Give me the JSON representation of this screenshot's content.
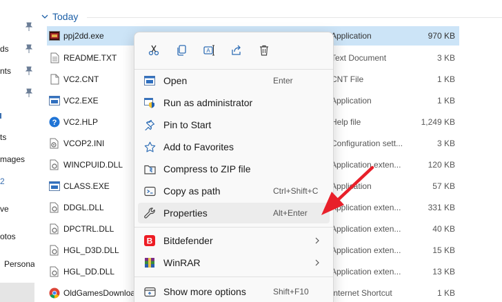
{
  "nav": {
    "items": [
      {
        "label": "ds"
      },
      {
        "label": "nts"
      },
      {
        "label": "ts"
      },
      {
        "label": "mages"
      },
      {
        "label": "2"
      },
      {
        "label": "ve"
      },
      {
        "label": "otos"
      },
      {
        "label": "Personal"
      }
    ]
  },
  "group": {
    "label": "Today"
  },
  "files": [
    {
      "name": "ppj2dd.exe",
      "type": "Application",
      "size": "970 KB",
      "icon": "app-exe-icon"
    },
    {
      "name": "README.TXT",
      "type": "Text Document",
      "size": "3 KB",
      "icon": "text-file-icon"
    },
    {
      "name": "VC2.CNT",
      "type": "CNT File",
      "size": "1 KB",
      "icon": "generic-file-icon"
    },
    {
      "name": "VC2.EXE",
      "type": "Application",
      "size": "1 KB",
      "icon": "window-exe-icon"
    },
    {
      "name": "VC2.HLP",
      "type": "Help file",
      "size": "1,249 KB",
      "icon": "help-file-icon"
    },
    {
      "name": "VCOP2.INI",
      "type": "Configuration sett...",
      "size": "3 KB",
      "icon": "settings-file-icon"
    },
    {
      "name": "WINCPUID.DLL",
      "type": "Application exten...",
      "size": "120 KB",
      "icon": "dll-file-icon"
    },
    {
      "name": "CLASS.EXE",
      "type": "Application",
      "size": "57 KB",
      "icon": "window-exe-icon"
    },
    {
      "name": "DDGL.DLL",
      "type": "Application exten...",
      "size": "331 KB",
      "icon": "dll-file-icon"
    },
    {
      "name": "DPCTRL.DLL",
      "type": "Application exten...",
      "size": "40 KB",
      "icon": "dll-file-icon"
    },
    {
      "name": "HGL_D3D.DLL",
      "type": "Application exten...",
      "size": "15 KB",
      "icon": "dll-file-icon"
    },
    {
      "name": "HGL_DD.DLL",
      "type": "Application exten...",
      "size": "13 KB",
      "icon": "dll-file-icon"
    },
    {
      "name": "OldGamesDownloa",
      "type": "Internet Shortcut",
      "size": "1 KB",
      "icon": "chrome-shortcut-icon"
    }
  ],
  "context_menu": {
    "toolbar": [
      {
        "name": "cut",
        "icon": "scissors-icon"
      },
      {
        "name": "copy",
        "icon": "copy-icon"
      },
      {
        "name": "rename",
        "icon": "rename-icon"
      },
      {
        "name": "share",
        "icon": "share-icon"
      },
      {
        "name": "delete",
        "icon": "trash-icon"
      }
    ],
    "items": [
      {
        "label": "Open",
        "shortcut": "Enter",
        "icon": "app-window-icon"
      },
      {
        "label": "Run as administrator",
        "shortcut": "",
        "icon": "admin-shield-icon"
      },
      {
        "label": "Pin to Start",
        "shortcut": "",
        "icon": "pin-icon"
      },
      {
        "label": "Add to Favorites",
        "shortcut": "",
        "icon": "star-icon"
      },
      {
        "label": "Compress to ZIP file",
        "shortcut": "",
        "icon": "zip-folder-icon"
      },
      {
        "label": "Copy as path",
        "shortcut": "Ctrl+Shift+C",
        "icon": "copy-path-icon"
      },
      {
        "label": "Properties",
        "shortcut": "Alt+Enter",
        "icon": "wrench-icon"
      },
      {
        "label": "Bitdefender",
        "shortcut": "",
        "icon": "bitdefender-icon"
      },
      {
        "label": "WinRAR",
        "shortcut": "",
        "icon": "winrar-icon"
      },
      {
        "label": "Show more options",
        "shortcut": "Shift+F10",
        "icon": "more-options-icon"
      }
    ]
  },
  "colors": {
    "selected_row": "#cce4f7",
    "group_header": "#1b5ea6",
    "annotation": "#e8202a",
    "bitdefender": "#ed1c24"
  }
}
